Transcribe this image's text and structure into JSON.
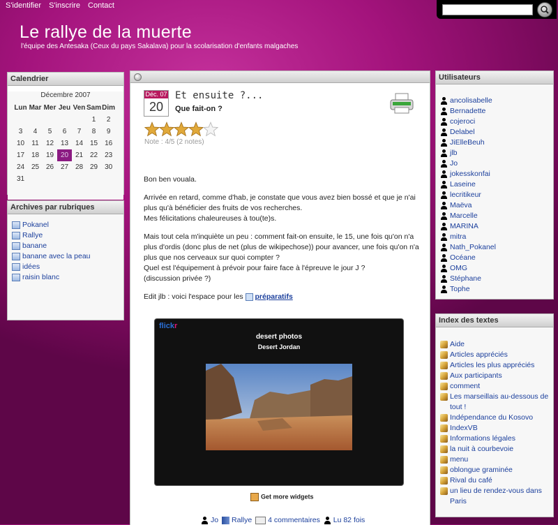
{
  "topnav": {
    "login": "S'identifier",
    "register": "S'inscrire",
    "contact": "Contact"
  },
  "search": {
    "placeholder": ""
  },
  "site": {
    "title": "Le rallye de la muerte",
    "subtitle": "l'équipe des Antesaka (Ceux du pays Sakalava) pour la scolarisation d'enfants malgaches"
  },
  "calendar": {
    "title": "Calendrier",
    "month": "Décembre 2007",
    "days": [
      "Lun",
      "Mar",
      "Mer",
      "Jeu",
      "Ven",
      "Sam",
      "Dim"
    ],
    "weeks": [
      [
        "",
        "",
        "",
        "",
        "",
        "1",
        "2"
      ],
      [
        "3",
        "4",
        "5",
        "6",
        "7",
        "8",
        "9"
      ],
      [
        "10",
        "11",
        "12",
        "13",
        "14",
        "15",
        "16"
      ],
      [
        "17",
        "18",
        "19",
        "20",
        "21",
        "22",
        "23"
      ],
      [
        "24",
        "25",
        "26",
        "27",
        "28",
        "29",
        "30"
      ],
      [
        "31",
        "",
        "",
        "",
        "",
        "",
        ""
      ]
    ],
    "today": "20"
  },
  "archives": {
    "title": "Archives par rubriques",
    "items": [
      "Pokanel",
      "Rallye",
      "banane",
      "banane avec la peau",
      "idées",
      "raisin blanc"
    ]
  },
  "post": {
    "month": "Déc. 07",
    "day": "20",
    "title": "Et ensuite ?...",
    "subtitle": "Que fait-on ?",
    "rating": 4,
    "rating_max": 5,
    "rating_text": "Note : 4/5 (2 notes)",
    "p1": "Bon ben vouala.",
    "p2": "Arrivée en retard, comme d'hab, je constate que vous avez bien bossé et que je n'ai plus qu'à bénéficier des fruits de vos recherches.",
    "p2b": "Mes félicitations chaleureuses à tou(te)s.",
    "p3a": "Mais tout cela m'inquiète un peu : comment fait-on ensuite, le 15, une fois qu'on n'a plus d'ordis (donc plus de net (plus de wikipechose)) pour avancer, une fois qu'on n'a plus que nos cerveaux sur quoi compter ?",
    "p3b": "Quel est l'équipement à prévoir pour faire face à l'épreuve le jour J ?",
    "p3c": "(discussion privée ?)",
    "edit_text": "Edit jlb : voici l'espace pour les",
    "edit_link": "préparatifs",
    "flickr_logo_a": "flick",
    "flickr_logo_b": "r",
    "flickr_title": "desert photos",
    "flickr_sub": "Desert Jordan",
    "widgets": "Get more widgets",
    "author": "Jo",
    "category": "Rallye",
    "comments": "4 commentaires",
    "reads": "Lu 82 fois"
  },
  "users": {
    "title": "Utilisateurs",
    "items": [
      "ancolisabelle",
      "Bernadette",
      "cojeroci",
      "Delabel",
      "JiElleBeuh",
      "jlb",
      "Jo",
      "jokesskonfai",
      "Laseine",
      "lecritikeur",
      "Maëva",
      "Marcelle",
      "MARINA",
      "mitra",
      "Nath_Pokanel",
      "Océane",
      "OMG",
      "Stéphane",
      "Tophe"
    ]
  },
  "index": {
    "title": "Index des textes",
    "items": [
      "Aide",
      "Articles appréciés",
      "Articles les plus appréciés",
      "Aux participants",
      "comment",
      "Les marseillais au-dessous de",
      "tout !",
      "Indépendance du Kosovo",
      "IndexVB",
      "Informations légales",
      "la nuit à courbevoie",
      "menu",
      "oblongue graminée",
      "Rival du café",
      "un lieu de rendez-vous dans",
      "Paris"
    ]
  }
}
